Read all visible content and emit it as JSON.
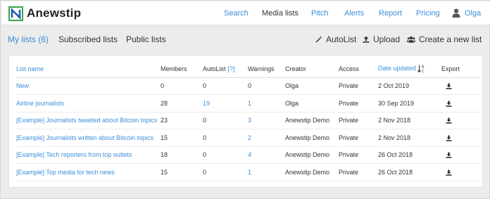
{
  "app": {
    "name": "Anewstip"
  },
  "nav": {
    "items": [
      {
        "label": "Search",
        "active": false
      },
      {
        "label": "Media lists",
        "active": true
      },
      {
        "label": "Pitch",
        "active": false
      },
      {
        "label": "Alerts",
        "active": false
      },
      {
        "label": "Report",
        "active": false
      },
      {
        "label": "Pricing",
        "active": false
      }
    ],
    "user": "Olga"
  },
  "tabs": [
    {
      "label": "My lists (6)",
      "active": true
    },
    {
      "label": "Subscribed lists",
      "active": false
    },
    {
      "label": "Public lists",
      "active": false
    }
  ],
  "actions": {
    "autolist": "AutoList",
    "upload": "Upload",
    "create": "Create a new list"
  },
  "table": {
    "headers": {
      "name": "List name",
      "members": "Members",
      "autolist": "AutoList",
      "autolist_hint": "[?]",
      "warnings": "Warnings",
      "creator": "Creator",
      "access": "Access",
      "date": "Date updated",
      "export": "Export"
    },
    "rows": [
      {
        "name": "New",
        "members": "0",
        "autolist": "0",
        "warnings": "0",
        "creator": "Olga",
        "access": "Private",
        "date": "2 Oct 2019"
      },
      {
        "name": "Airline journalists",
        "members": "28",
        "autolist": "19",
        "warnings": "1",
        "creator": "Olga",
        "access": "Private",
        "date": "30 Sep 2019"
      },
      {
        "name": "[Example] Journalists tweeted about Bitcoin topics",
        "members": "23",
        "autolist": "0",
        "warnings": "3",
        "creator": "Anewstip Demo",
        "access": "Private",
        "date": "2 Nov 2018"
      },
      {
        "name": "[Example] Journalists written about Bitcoin topics",
        "members": "15",
        "autolist": "0",
        "warnings": "2",
        "creator": "Anewstip Demo",
        "access": "Private",
        "date": "2 Nov 2018"
      },
      {
        "name": "[Example] Tech reporters from top outlets",
        "members": "18",
        "autolist": "0",
        "warnings": "4",
        "creator": "Anewstip Demo",
        "access": "Private",
        "date": "26 Oct 2018"
      },
      {
        "name": "[Example] Top media for tech news",
        "members": "15",
        "autolist": "0",
        "warnings": "1",
        "creator": "Anewstip Demo",
        "access": "Private",
        "date": "26 Oct 2018"
      }
    ]
  },
  "colors": {
    "accent": "#3b8fd9",
    "logo_green": "#3aa34a",
    "background": "#ececec"
  },
  "icons": {
    "logo": "anewstip-logo-icon",
    "user": "user-icon",
    "autolist": "magic-wand-icon",
    "upload": "upload-icon",
    "create": "users-icon",
    "sort": "sort-alpha-icon",
    "export": "download-icon"
  }
}
